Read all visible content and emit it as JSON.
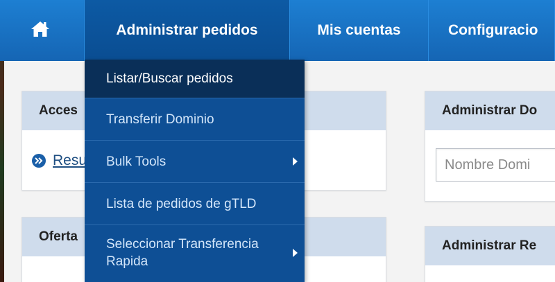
{
  "nav": {
    "home_icon": "home-icon",
    "items": [
      {
        "label": "Administrar pedidos",
        "active": true
      },
      {
        "label": "Mis cuentas"
      },
      {
        "label": "Configuracio"
      }
    ]
  },
  "dropdown": {
    "items": [
      {
        "label": "Listar/Buscar pedidos",
        "highlighted": true
      },
      {
        "label": "Transferir Dominio"
      },
      {
        "label": "Bulk Tools",
        "has_submenu": true
      },
      {
        "label": "Lista de pedidos de gTLD"
      },
      {
        "label": "Seleccionar Transferencia Rapida",
        "has_submenu": true
      }
    ]
  },
  "panels": {
    "accesos": {
      "title": "Acces",
      "link_label": "Resu"
    },
    "ofertas": {
      "title": "Oferta"
    },
    "administrar_dominios": {
      "title": "Administrar Do",
      "input_placeholder": "Nombre Domi"
    },
    "administrar_re": {
      "title": "Administrar Re"
    }
  },
  "colors": {
    "nav_bg": "#1a73c6",
    "nav_active": "#0c549c",
    "dropdown_bg": "#0e4f95",
    "dropdown_highlight": "#0a2f58",
    "panel_head_bg": "#cfdcec"
  }
}
